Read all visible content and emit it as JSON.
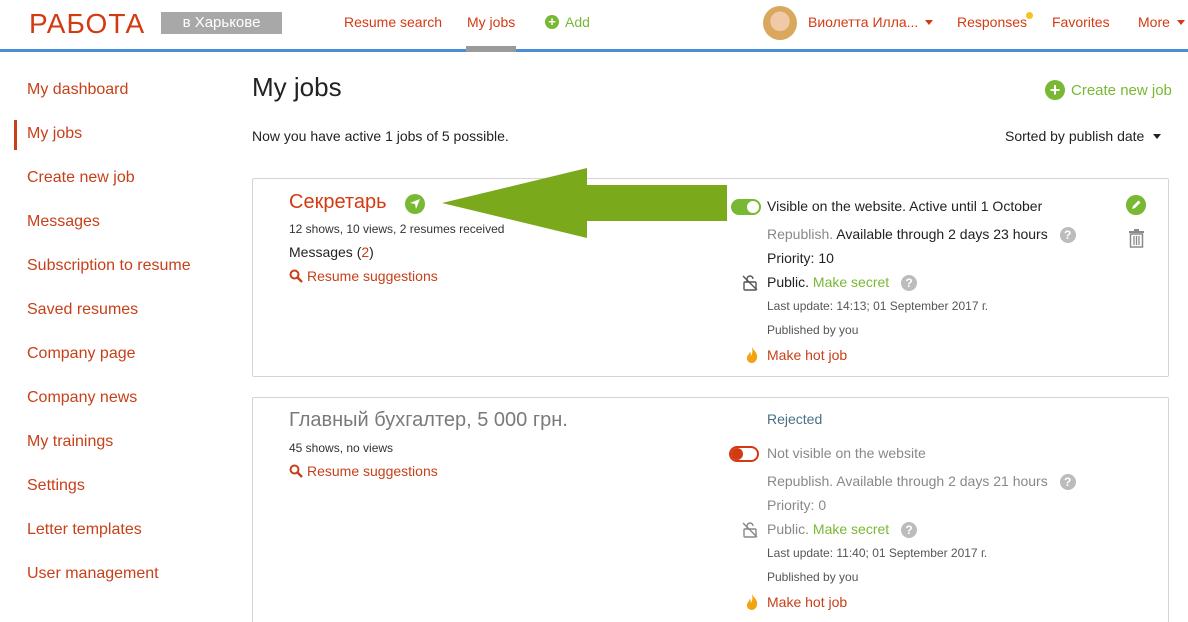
{
  "header": {
    "logo": "РАБОТА",
    "city": "в Харькове",
    "nav": {
      "resume_search": "Resume search",
      "my_jobs": "My jobs",
      "add": "Add"
    },
    "user": {
      "name": "Виолетта Илла..."
    },
    "right_nav": {
      "responses": "Responses",
      "favorites": "Favorites",
      "more": "More"
    }
  },
  "sidebar": {
    "items": [
      {
        "label": "My dashboard"
      },
      {
        "label": "My jobs",
        "active": true
      },
      {
        "label": "Create new job"
      },
      {
        "label": "Messages"
      },
      {
        "label": "Subscription to resume"
      },
      {
        "label": "Saved resumes"
      },
      {
        "label": "Company page"
      },
      {
        "label": "Company news"
      },
      {
        "label": "My trainings"
      },
      {
        "label": "Settings"
      },
      {
        "label": "Letter templates"
      },
      {
        "label": "User management"
      }
    ]
  },
  "main": {
    "title": "My jobs",
    "create_new_job": "Create new job",
    "active_info": "Now you have active 1 jobs of 5 possible.",
    "sort_label": "Sorted by publish date"
  },
  "jobs": [
    {
      "title": "Секретарь",
      "stats": "12 shows, 10 views, 2 resumes received",
      "messages_label": "Messages",
      "messages_count": "2",
      "suggestions": "Resume suggestions",
      "visibility": "Visible on the website. Active until 1 October",
      "republish_link": "Republish.",
      "republish_info": "Available through 2 days 23 hours",
      "priority": "Priority: 10",
      "public_label": "Public.",
      "make_secret": "Make secret",
      "last_update": "Last update: 14:13; 01 September 2017 г.",
      "published_by": "Published by you",
      "make_hot": "Make hot job"
    },
    {
      "title": "Главный бухгалтер, 5 000 грн.",
      "stats": "45 shows, no views",
      "suggestions": "Resume suggestions",
      "status": "Rejected",
      "visibility": "Not visible on the website",
      "republish_info": "Republish. Available through 2 days 21 hours",
      "priority": "Priority: 0",
      "public_label": "Public.",
      "make_secret": "Make secret",
      "last_update": "Last update: 11:40; 01 September 2017 г.",
      "published_by": "Published by you",
      "make_hot": "Make hot job"
    }
  ],
  "colors": {
    "brand_red": "#d43a12",
    "accent_green": "#79b833",
    "header_blue": "#4a8fd6"
  }
}
